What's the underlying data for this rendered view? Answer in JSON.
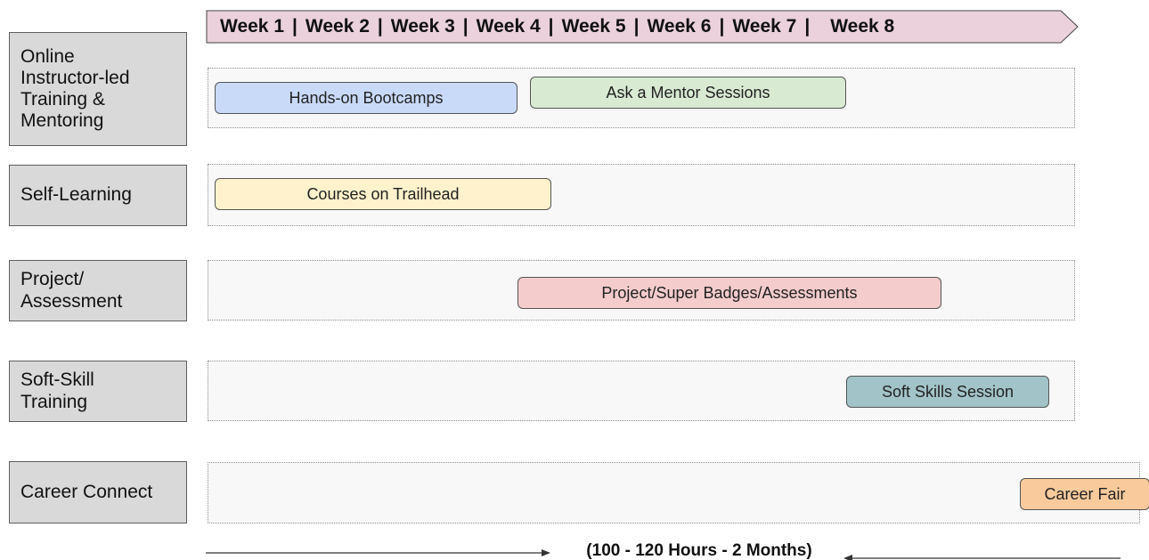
{
  "timeline": {
    "weeks": [
      "Week 1",
      "Week 2",
      "Week 3",
      "Week 4",
      "Week 5",
      "Week 6",
      "Week 7",
      "Week 8"
    ],
    "separator": "|",
    "banner_color": "#ead1dc"
  },
  "rows": [
    {
      "label": "Online\nInstructor-led\nTraining &\nMentoring",
      "bars": [
        {
          "label": "Hands-on Bootcamps",
          "color": "#c9daf8"
        },
        {
          "label": "Ask a Mentor Sessions",
          "color": "#d9ead3"
        }
      ]
    },
    {
      "label": "Self-Learning",
      "bars": [
        {
          "label": "Courses on Trailhead",
          "color": "#fff2cc"
        }
      ]
    },
    {
      "label": "Project/\nAssessment",
      "bars": [
        {
          "label": "Project/Super Badges/Assessments",
          "color": "#f4cccc"
        }
      ]
    },
    {
      "label": "Soft-Skill\nTraining",
      "bars": [
        {
          "label": "Soft Skills Session",
          "color": "#a2c4c9"
        }
      ]
    },
    {
      "label": "Career Connect",
      "bars": [
        {
          "label": "Career Fair",
          "color": "#f9cb9c"
        }
      ]
    }
  ],
  "footer": {
    "duration_label": "(100 - 120 Hours - 2 Months)"
  }
}
